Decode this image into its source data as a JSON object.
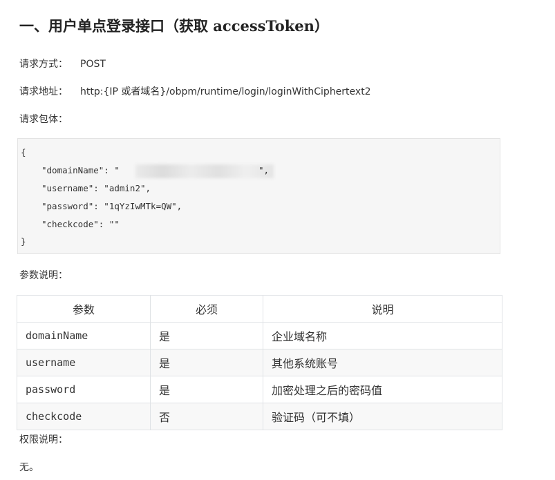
{
  "title": "一、用户单点登录接口（获取 accessToken）",
  "request": {
    "method_label": "请求方式：",
    "method_value": "POST",
    "url_label": "请求地址：",
    "url_value": "http:{IP 或者域名}/obpm/runtime/login/loginWithCiphertext2",
    "body_label": "请求包体："
  },
  "code": {
    "open": "{",
    "lines": [
      "\"domainName\": \"",
      "\"username\": \"admin2\",",
      "\"password\": \"1qYzIwMTk=QW\",",
      "\"checkcode\": \"\""
    ],
    "domain_tail": "\",",
    "close": "}"
  },
  "params": {
    "label": "参数说明：",
    "headers": [
      "参数",
      "必须",
      "说明"
    ],
    "rows": [
      [
        "domainName",
        "是",
        "企业域名称"
      ],
      [
        "username",
        "是",
        "其他系统账号"
      ],
      [
        "password",
        "是",
        "加密处理之后的密码值"
      ],
      [
        "checkcode",
        "否",
        "验证码（可不填）"
      ]
    ]
  },
  "permission": {
    "label": "权限说明：",
    "value": "无。"
  }
}
